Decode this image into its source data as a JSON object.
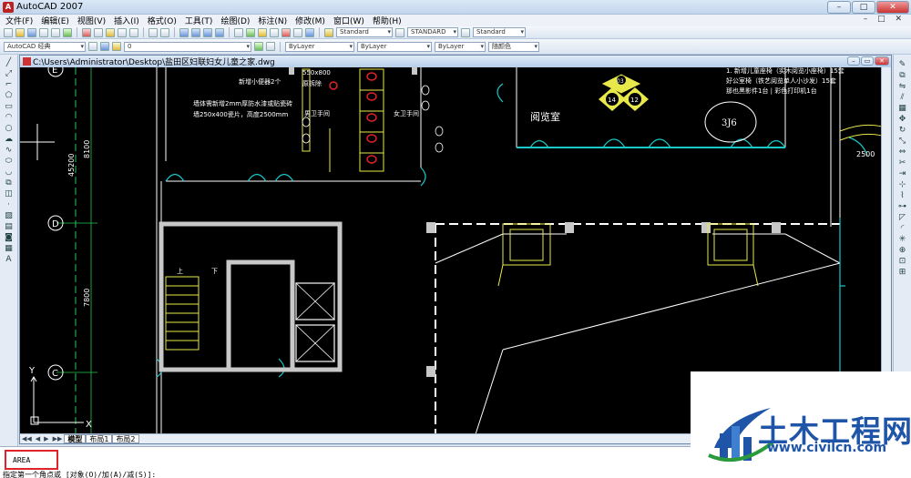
{
  "app": {
    "title": "AutoCAD 2007"
  },
  "menu": [
    "文件(F)",
    "编辑(E)",
    "视图(V)",
    "插入(I)",
    "格式(O)",
    "工具(T)",
    "绘图(D)",
    "标注(N)",
    "修改(M)",
    "窗口(W)",
    "帮助(H)"
  ],
  "toolbar": {
    "text_style": "Standard",
    "dim_style": "STANDARD",
    "table_style": "Standard",
    "workspace": "AutoCAD 经典",
    "layer": "0",
    "color": "ByLayer",
    "linetype": "ByLayer",
    "lineweight": "ByLayer",
    "plotstyle": "随颜色"
  },
  "document": {
    "title": "C:\\Users\\Administrator\\Desktop\\盐田区妇联妇女儿童之家.dwg"
  },
  "drawing": {
    "grid_labels": [
      "E",
      "D",
      "C"
    ],
    "dimensions": [
      "8100",
      "45200",
      "7800",
      "550x800",
      "2500"
    ],
    "room_label": "阅览室",
    "room_number": "3J6",
    "annotations": [
      "新增小便器2个",
      "墙体需新增2mm厚防水漆或贴瓷砖",
      "墙250x400瓷片，高度2500mm",
      "原拆除",
      "男卫手间",
      "女卫手间"
    ],
    "notes_right": [
      "1. 新增儿童座椅（实木阅览小座椅）15套",
      "好公室椅（铁艺阅览单人小沙发）15套",
      "那也黑影件1台 | 彩色打印机1台"
    ],
    "bubbles": [
      "03",
      "12",
      "14"
    ],
    "stair_labels": [
      "上",
      "下"
    ]
  },
  "tabs": [
    "模型",
    "布局1",
    "布局2"
  ],
  "command": {
    "history": "AREA",
    "prompt": "指定第一个角点或 [对象(O)/加(A)/减(S)]:"
  },
  "watermark": {
    "brand": "土木工程网",
    "url": "www.civilcn.com"
  },
  "colors": {
    "background": "#000000",
    "cyan": "#19c8c8",
    "white": "#ffffff",
    "yellow": "#e8e84a",
    "red": "#e0222a",
    "green": "#22c84a",
    "brand": "#1f55a8"
  }
}
